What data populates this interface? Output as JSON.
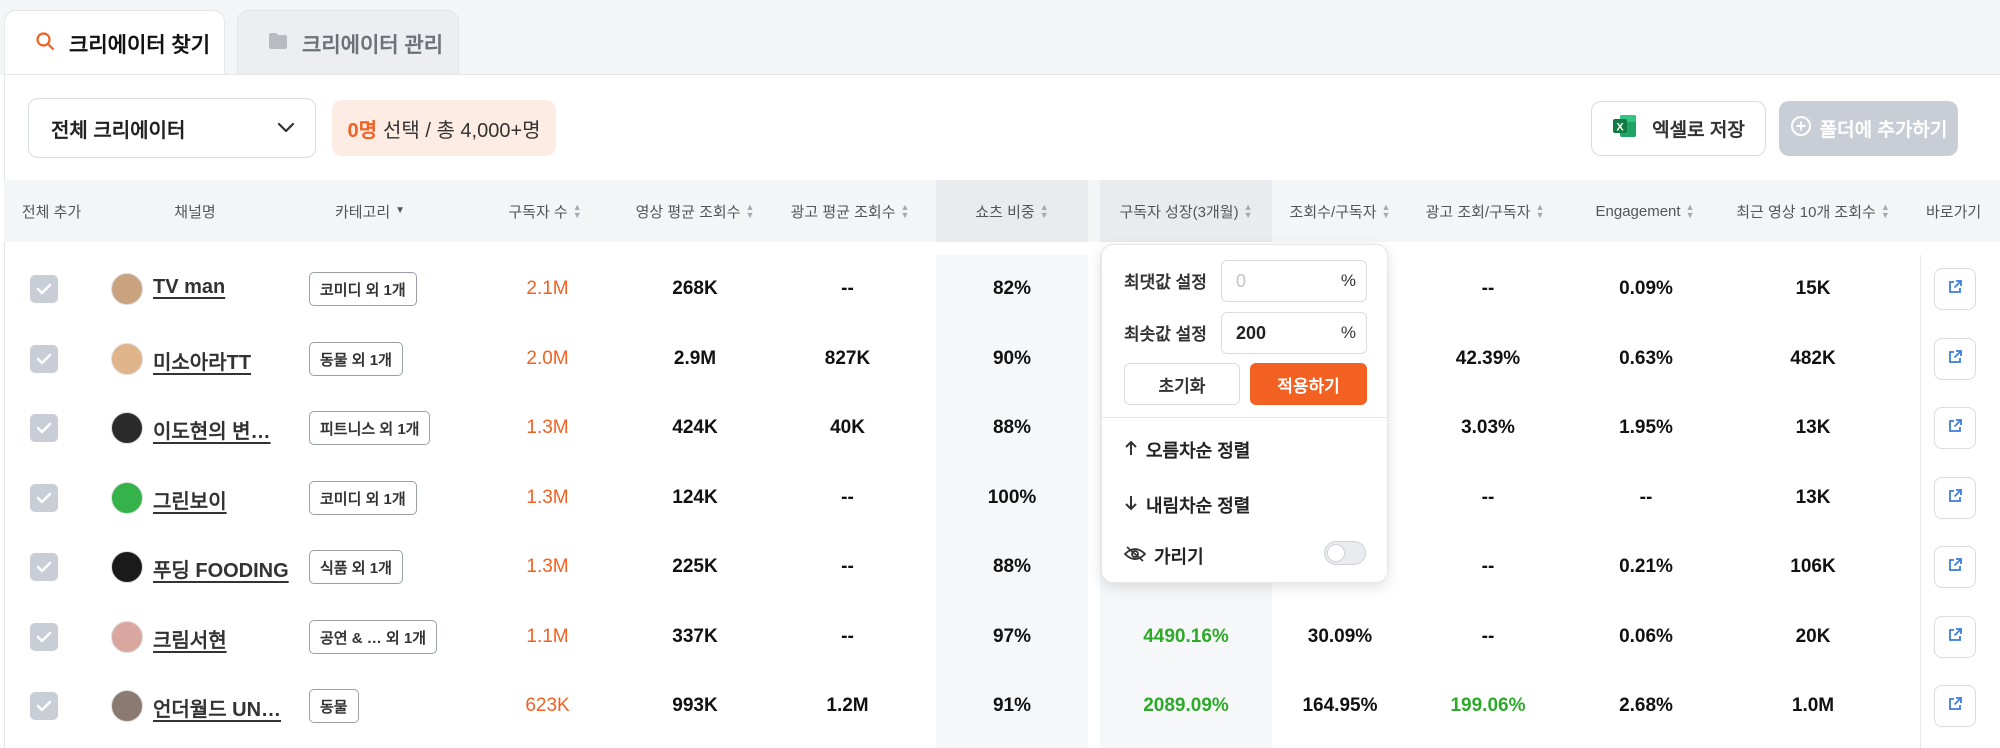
{
  "tabs": {
    "find": "크리에이터 찾기",
    "manage": "크리에이터 관리"
  },
  "toolbar": {
    "dropdown_value": "전체 크리에이터",
    "selected_count": "0명",
    "selected_rest": "선택 / 총 4,000+명",
    "excel_label": "엑셀로 저장",
    "folder_label": "폴더에 추가하기"
  },
  "columns": {
    "add_all": "전체 추가",
    "channel": "채널명",
    "category": "카테고리",
    "subscribers": "구독자 수",
    "avg_views": "영상 평균 조회수",
    "ad_avg_views": "광고 평균 조회수",
    "shorts_ratio": "쇼츠 비중",
    "sub_growth": "구독자 성장(3개월)",
    "views_per_sub": "조회수/구독자",
    "ad_views_per_sub": "광고 조회/구독자",
    "engagement": "Engagement",
    "recent10": "최근 영상 10개 조회수",
    "goto": "바로가기"
  },
  "rows": [
    {
      "name": "TV man",
      "category": "코미디 외 1개",
      "subscribers": "2.1M",
      "avg_views": "268K",
      "ad_avg_views": "--",
      "shorts_ratio": "82%",
      "sub_growth": "",
      "views_per_sub": "",
      "ad_views_per_sub": "--",
      "engagement": "0.09%",
      "recent10": "15K"
    },
    {
      "name": "미소아라TT",
      "category": "동물 외 1개",
      "subscribers": "2.0M",
      "avg_views": "2.9M",
      "ad_avg_views": "827K",
      "shorts_ratio": "90%",
      "sub_growth": "",
      "views_per_sub": "",
      "ad_views_per_sub": "42.39%",
      "engagement": "0.63%",
      "recent10": "482K"
    },
    {
      "name": "이도현의 변…",
      "category": "피트니스 외 1개",
      "subscribers": "1.3M",
      "avg_views": "424K",
      "ad_avg_views": "40K",
      "shorts_ratio": "88%",
      "sub_growth": "",
      "views_per_sub": "",
      "ad_views_per_sub": "3.03%",
      "engagement": "1.95%",
      "recent10": "13K"
    },
    {
      "name": "그린보이",
      "category": "코미디 외 1개",
      "subscribers": "1.3M",
      "avg_views": "124K",
      "ad_avg_views": "--",
      "shorts_ratio": "100%",
      "sub_growth": "",
      "views_per_sub": "",
      "ad_views_per_sub": "--",
      "engagement": "--",
      "recent10": "13K"
    },
    {
      "name": "푸딩 FOODING",
      "category": "식품 외 1개",
      "subscribers": "1.3M",
      "avg_views": "225K",
      "ad_avg_views": "--",
      "shorts_ratio": "88%",
      "sub_growth": "",
      "views_per_sub": "",
      "ad_views_per_sub": "--",
      "engagement": "0.21%",
      "recent10": "106K"
    },
    {
      "name": "크림서현",
      "category": "공연 & … 외 1개",
      "subscribers": "1.1M",
      "avg_views": "337K",
      "ad_avg_views": "--",
      "shorts_ratio": "97%",
      "sub_growth": "4490.16%",
      "views_per_sub": "30.09%",
      "ad_views_per_sub": "--",
      "engagement": "0.06%",
      "recent10": "20K"
    },
    {
      "name": "언더월드 UN…",
      "category": "동물",
      "subscribers": "623K",
      "avg_views": "993K",
      "ad_avg_views": "1.2M",
      "shorts_ratio": "91%",
      "sub_growth": "2089.09%",
      "views_per_sub": "164.95%",
      "ad_views_per_sub": "199.06%",
      "engagement": "2.68%",
      "recent10": "1.0M"
    }
  ],
  "popup": {
    "max_label": "최댓값 설정",
    "max_placeholder": "0",
    "min_label": "최솟값 설정",
    "min_value": "200",
    "unit": "%",
    "reset": "초기화",
    "apply": "적용하기",
    "sort_asc": "오름차순 정렬",
    "sort_desc": "내림차순 정렬",
    "hide": "가리기",
    "hide_toggle_on": false
  },
  "colors": {
    "accent": "#f26122",
    "growth": "#2eaa2a",
    "disabled": "#c9ced6"
  },
  "icons": {
    "tab_find": "search-icon",
    "tab_manage": "folder-icon",
    "dropdown": "chevron-down-icon",
    "excel": "excel-icon",
    "folder": "plus-circle-icon",
    "link": "external-link-icon",
    "hide": "eye-off-icon",
    "asc": "arrow-up-icon",
    "desc": "arrow-down-icon"
  }
}
